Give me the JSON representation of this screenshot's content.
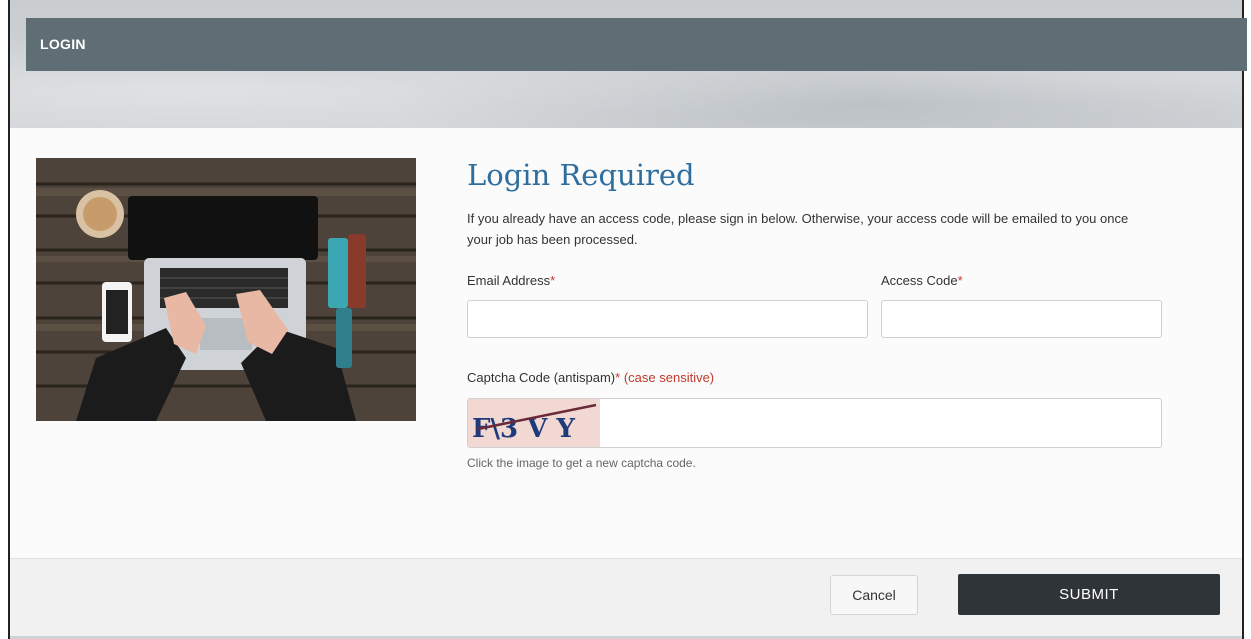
{
  "header": {
    "title": "LOGIN"
  },
  "content": {
    "title": "Login Required",
    "intro": "If you already have an access code, please sign in below. Otherwise, your access code will be emailed to you once your job has been processed.",
    "email": {
      "label": "Email Address",
      "required_mark": "*",
      "value": ""
    },
    "access_code": {
      "label": "Access Code",
      "required_mark": "*",
      "value": ""
    },
    "captcha": {
      "label": "Captcha Code (antispam)",
      "required_mark": "*",
      "case_hint": "(case sensitive)",
      "image_text": "F\\3 V Y",
      "value": "",
      "note": "Click the image to get a new captcha code."
    }
  },
  "footer": {
    "cancel_label": "Cancel",
    "submit_label": "SUBMIT"
  },
  "colors": {
    "header_bg": "#5f6d75",
    "title": "#2e6e9e",
    "required": "#c0392b",
    "submit_bg": "#2f3439"
  },
  "icons": {
    "photo": "laptop-desk-photo"
  }
}
